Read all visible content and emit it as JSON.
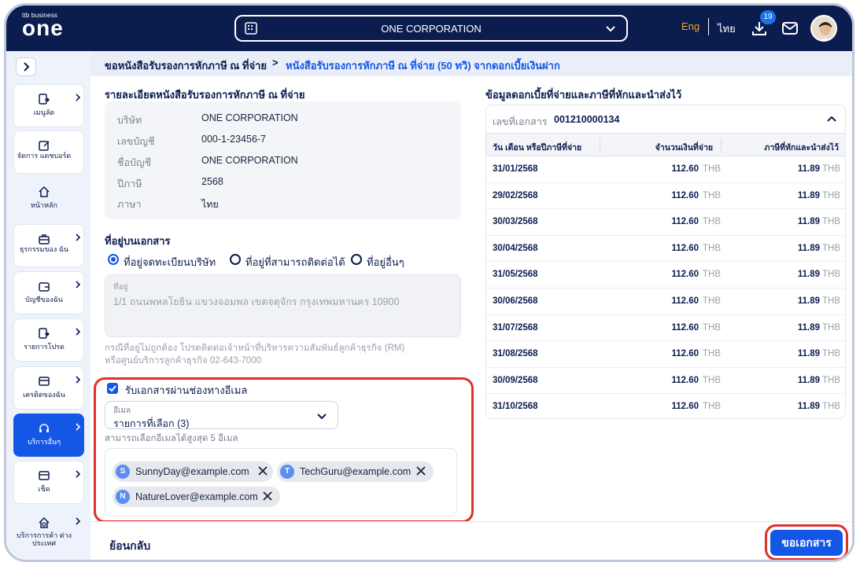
{
  "brand": {
    "small": "ttb business",
    "big": "one"
  },
  "header": {
    "company": "ONE CORPORATION",
    "lang_eng": "Eng",
    "lang_th": "ไทย",
    "download_badge": "19"
  },
  "sidebar": {
    "items": [
      {
        "label": "เมนูลัด"
      },
      {
        "label": "จัดการ แดชบอร์ด"
      },
      {
        "label": "หน้าหลัก"
      },
      {
        "label": "ธุรกรรมของ ฉัน"
      },
      {
        "label": "บัญชีของฉัน"
      },
      {
        "label": "รายการโปรด"
      },
      {
        "label": "เครดิตของฉัน"
      },
      {
        "label": "บริการอื่นๆ"
      },
      {
        "label": "เช็ค"
      },
      {
        "label": "บริการการค้า ต่างประเทศ"
      }
    ]
  },
  "breadcrumb": {
    "parent": "ขอหนังสือรับรองการหักภาษี ณ ที่จ่าย",
    "separator": ">",
    "current": "หนังสือรับรองการหักภาษี ณ ที่จ่าย (50 ทวิ) จากดอกเบี้ยเงินฝาก"
  },
  "details": {
    "title": "รายละเอียดหนังสือรับรองการหักภาษี ณ ที่จ่าย",
    "rows": [
      {
        "key": "บริษัท",
        "value": "ONE CORPORATION"
      },
      {
        "key": "เลขบัญชี",
        "value": "000-1-23456-7"
      },
      {
        "key": "ชื่อบัญชี",
        "value": "ONE CORPORATION"
      },
      {
        "key": "ปีภาษี",
        "value": "2568"
      },
      {
        "key": "ภาษา",
        "value": "ไทย"
      }
    ]
  },
  "address": {
    "title": "ที่อยู่บนเอกสาร",
    "options": [
      "ที่อยู่จดทะเบียนบริษัท",
      "ที่อยู่ที่สามารถติดต่อได้",
      "ที่อยู่อื่นๆ"
    ],
    "selected": 0,
    "field_label": "ที่อยู่",
    "field_value": "1/1 ถนนพหลโยธิน แขวงจอมพล เขตจตุจักร กรุงเทพมหานคร 10900",
    "note_line1": "กรณีที่อยู่ไม่ถูกต้อง โปรดติดต่อเจ้าหน้าที่บริหารความสัมพันธ์ลูกค้าธุรกิจ (RM)",
    "note_line2": "หรือศูนย์บริการลูกค้าธุรกิจ 02-643-7000"
  },
  "email": {
    "checkbox_label": "รับเอกสารผ่านช่องทางอีเมล",
    "select_label": "อีเมล",
    "select_value": "รายการที่เลือก (3)",
    "hint": "สามารถเลือกอีเมลได้สูงสุด 5 อีเมล",
    "chips": [
      {
        "initial": "S",
        "email": "SunnyDay@example.com"
      },
      {
        "initial": "T",
        "email": "TechGuru@example.com"
      },
      {
        "initial": "N",
        "email": "NatureLover@example.com"
      }
    ]
  },
  "interest": {
    "title": "ข้อมูลดอกเบี้ยที่จ่ายและภาษีที่หักและนำส่งไว้",
    "doc_label": "เลขที่เอกสาร",
    "doc_number": "001210000134",
    "columns": [
      "วัน เดือน หรือปีภาษีที่จ่าย",
      "จำนวนเงินที่จ่าย",
      "ภาษีที่หักและนำส่งไว้"
    ],
    "currency": "THB",
    "rows": [
      {
        "date": "31/01/2568",
        "amount": "112.60",
        "tax": "11.89"
      },
      {
        "date": "29/02/2568",
        "amount": "112.60",
        "tax": "11.89"
      },
      {
        "date": "30/03/2568",
        "amount": "112.60",
        "tax": "11.89"
      },
      {
        "date": "30/04/2568",
        "amount": "112.60",
        "tax": "11.89"
      },
      {
        "date": "31/05/2568",
        "amount": "112.60",
        "tax": "11.89"
      },
      {
        "date": "30/06/2568",
        "amount": "112.60",
        "tax": "11.89"
      },
      {
        "date": "31/07/2568",
        "amount": "112.60",
        "tax": "11.89"
      },
      {
        "date": "31/08/2568",
        "amount": "112.60",
        "tax": "11.89"
      },
      {
        "date": "30/09/2568",
        "amount": "112.60",
        "tax": "11.89"
      },
      {
        "date": "31/10/2568",
        "amount": "112.60",
        "tax": "11.89"
      }
    ]
  },
  "footer": {
    "back": "ย้อนกลับ",
    "submit": "ขอเอกสาร"
  },
  "colors": {
    "navy": "#0b1d4f",
    "primary": "#1457e6",
    "highlight": "#e0302b",
    "accent": "#f5a623"
  }
}
